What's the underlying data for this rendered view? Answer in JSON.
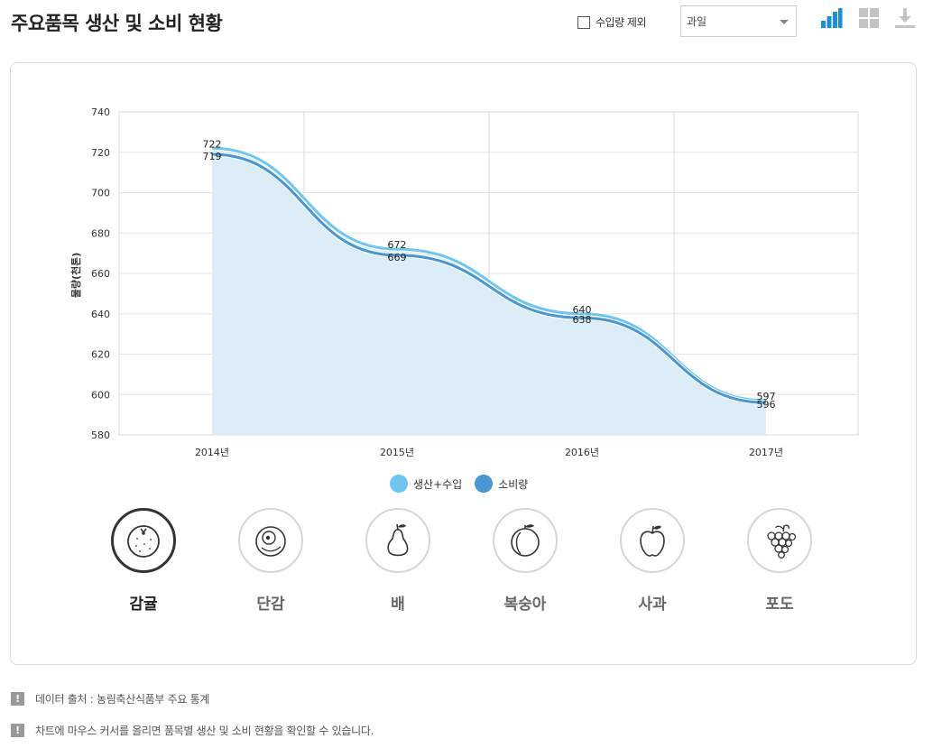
{
  "page": {
    "title": "주요품목 생산 및 소비 현황"
  },
  "controls": {
    "exclude_import_label": "수입량 제외",
    "exclude_import_checked": false,
    "category_selected": "과일",
    "icons": [
      "bar-chart-icon",
      "grid-view-icon",
      "download-icon"
    ],
    "accent_color": "#1a8fd8"
  },
  "chart_data": {
    "type": "area",
    "ylabel": "물량(천톤)",
    "xlabel": "",
    "categories": [
      "2014년",
      "2015년",
      "2016년",
      "2017년"
    ],
    "ylim": [
      580,
      740
    ],
    "yticks": [
      580,
      600,
      620,
      640,
      660,
      680,
      700,
      720,
      740
    ],
    "grid": true,
    "legend_position": "bottom-center",
    "series": [
      {
        "name": "생산+수입",
        "values": [
          722,
          672,
          640,
          597
        ],
        "color": "#6ec6ee"
      },
      {
        "name": "소비량",
        "values": [
          719,
          669,
          638,
          596
        ],
        "color": "#4a96cf"
      }
    ],
    "area_fill": "#ddedf7"
  },
  "fruits": [
    {
      "label": "감귤",
      "icon": "tangerine-icon",
      "active": true
    },
    {
      "label": "단감",
      "icon": "persimmon-icon",
      "active": false
    },
    {
      "label": "배",
      "icon": "pear-icon",
      "active": false
    },
    {
      "label": "복숭아",
      "icon": "peach-icon",
      "active": false
    },
    {
      "label": "사과",
      "icon": "apple-icon",
      "active": false
    },
    {
      "label": "포도",
      "icon": "grape-icon",
      "active": false
    }
  ],
  "notes": [
    "데이터 출처 : 농림축산식품부 주요 통계",
    "차트에 마우스 커서를 올리면 품목별 생산 및 소비 현황을 확인할 수 있습니다."
  ]
}
